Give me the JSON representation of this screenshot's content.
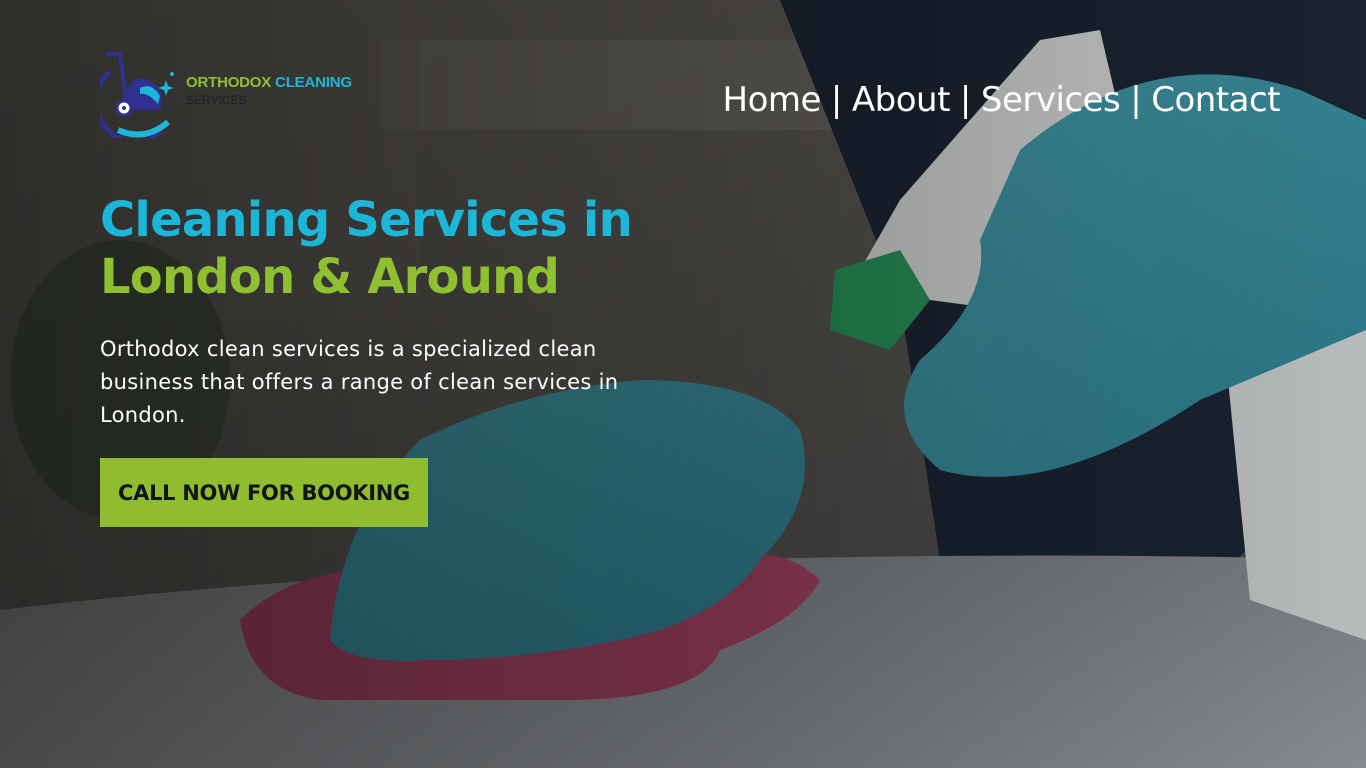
{
  "brand": {
    "name_part1": "ORTHODOX",
    "name_part2": "CLEANING",
    "tagline": "SERVICES",
    "logo_icon": "vacuum-cleaner-icon",
    "colors": {
      "green": "#8fc031",
      "blue": "#1cb6d8",
      "navy": "#2e3192"
    }
  },
  "nav": {
    "items": [
      {
        "label": "Home"
      },
      {
        "label": "About"
      },
      {
        "label": "Services"
      },
      {
        "label": "Contact"
      }
    ],
    "separator": "|"
  },
  "hero": {
    "headline_line1": "Cleaning Services in",
    "headline_line2": "London & Around",
    "description": "Orthodox clean services is a specialized clean business that offers a range of clean services in London.",
    "cta_label": "CALL NOW FOR BOOKING",
    "colors": {
      "accent_blue": "#1cb6d8",
      "accent_green": "#8fc031",
      "cta_bg": "#8fbd2f"
    }
  }
}
